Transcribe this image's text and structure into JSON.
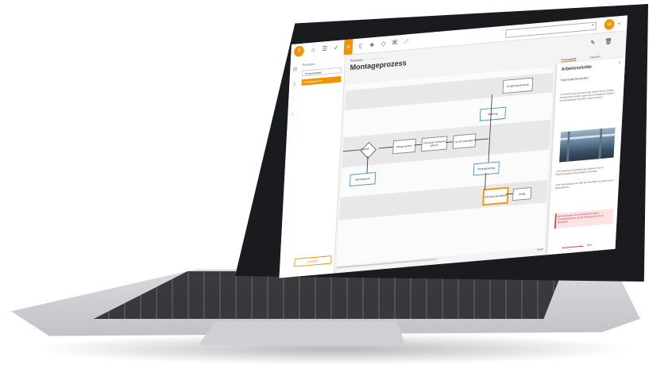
{
  "topbar": {
    "logo": "f",
    "icons": [
      "home-icon",
      "list-icon",
      "check-icon",
      "process-icon",
      "document-icon",
      "layers-icon",
      "shield-icon",
      "hierarchy-icon",
      "chart-icon"
    ],
    "search_icon": "⌕",
    "avatar": "SB",
    "chevron": "⌄"
  },
  "sidebar": {
    "header": "Prozesse",
    "items": [
      "Prozessmodell",
      "Montageprozess"
    ],
    "add_button": "Erstellen"
  },
  "main": {
    "breadcrumb": "Prozesse  ›   ·········   ›   ·········",
    "title": "Montageprozess",
    "tabs": [
      "Prozessgrafik",
      "Übersicht"
    ]
  },
  "diagram": {
    "nodes": {
      "n1": "Kundenbeschwerde",
      "n2": "Meldung",
      "n3": "Branch",
      "n4": "Menge prüfen",
      "n5": "Personal / Aufwand planen",
      "n6": "vor Ort anmelden",
      "n7": "Informationen",
      "n8": "Montageauftrag",
      "n9": "Fahrzeug bestücken",
      "n10": "Anlag"
    }
  },
  "panel": {
    "title": "Arbeitsschritte",
    "chevron": "^",
    "subtitle": "Fahrzeuge bestücken",
    "step1": "1  Die Bestückung der Fahrzeuge mit den für den Einsatz erforderlichen Geräten sowie deren Ausstattung erfolgt im Bereitschaftslager des BBK in Bonn-Duisdorf.",
    "step2": "2  Die aktuellen Bestandsmengen befinden sich im Bestückungsplan des jeweiligen Fahrzeugs.",
    "step3": "3  Die Bestückung ist mit Hilfe der Checkliste zu prüfen und zu dokumentieren.",
    "warning": "Bei Fahrzeugen ist die Wartung des Lagers (Verbraucherlisten) und die Wartung der Liste zu überprüfen."
  },
  "footer": {
    "zoom_label": "Zoom",
    "zoom_value": "80%"
  }
}
